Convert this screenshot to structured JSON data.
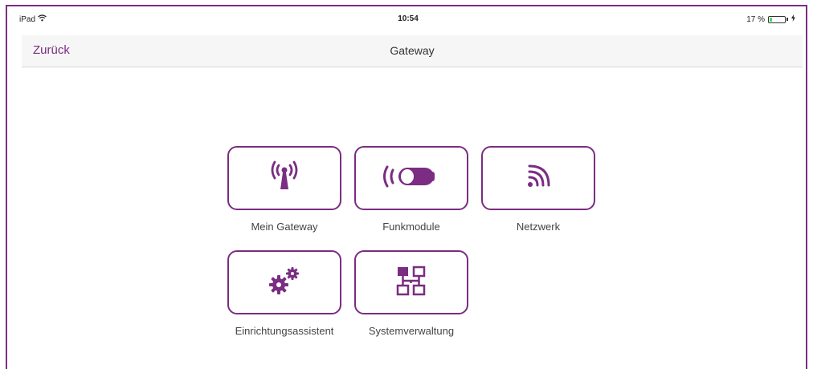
{
  "status_bar": {
    "device": "iPad",
    "time": "10:54",
    "battery_percent": "17 %",
    "battery_level": 0.17,
    "wifi_icon": "wifi-icon",
    "charging_icon": "charging-bolt-icon"
  },
  "nav": {
    "back_label": "Zurück",
    "title": "Gateway"
  },
  "tiles": [
    {
      "label": "Mein Gateway",
      "icon": "antenna-icon"
    },
    {
      "label": "Funkmodule",
      "icon": "radio-module-icon"
    },
    {
      "label": "Netzwerk",
      "icon": "network-signal-icon"
    },
    {
      "label": "Einrichtungsassistent",
      "icon": "gears-icon"
    },
    {
      "label": "Systemverwaltung",
      "icon": "system-tree-icon"
    }
  ],
  "colors": {
    "accent": "#7a2d82",
    "battery_green": "#4cd964"
  }
}
